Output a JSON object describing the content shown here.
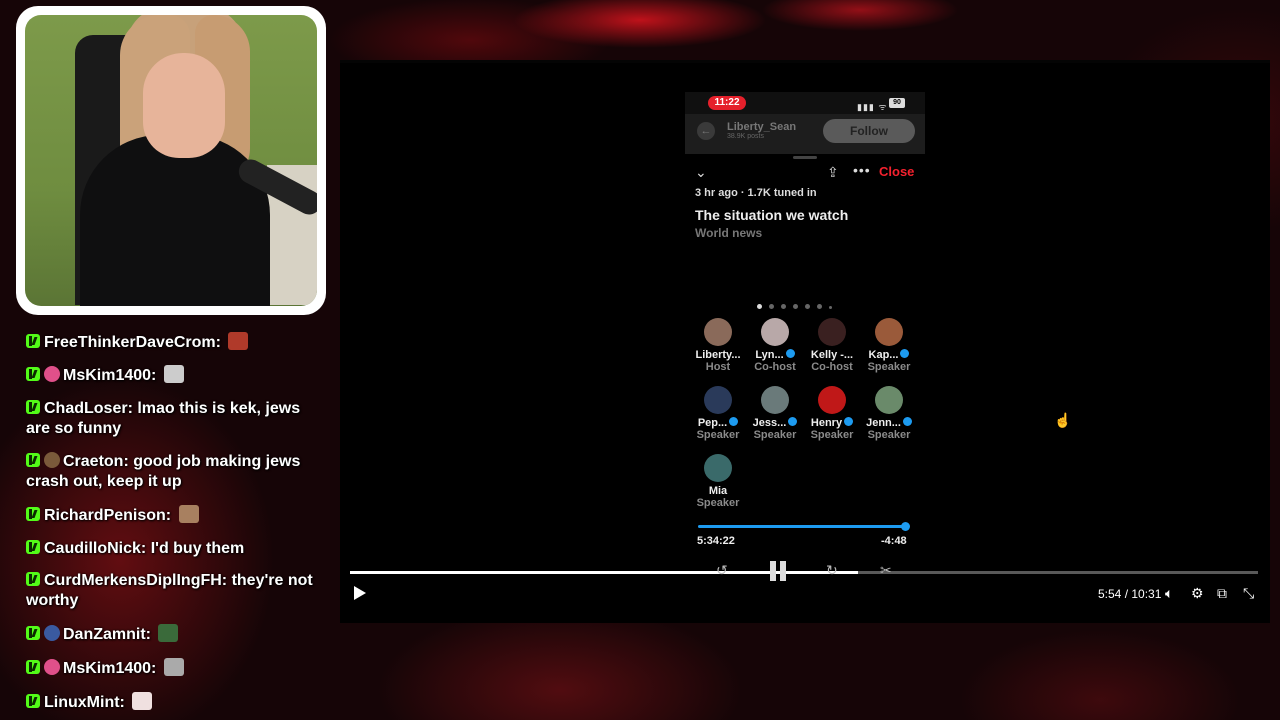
{
  "chat": {
    "messages": [
      {
        "user": "FreeThinkerDaveCrom:",
        "text": ""
      },
      {
        "user": "MsKim1400:",
        "text": ""
      },
      {
        "user": "ChadLoser:",
        "text": "lmao this is kek, jews are so funny"
      },
      {
        "user": "Craeton:",
        "text": "good job making jews crash out, keep it up"
      },
      {
        "user": "RichardPenison:",
        "text": ""
      },
      {
        "user": "CaudilloNick:",
        "text": "I'd buy them"
      },
      {
        "user": "CurdMerkensDiplIngFH:",
        "text": "they're not worthy"
      },
      {
        "user": "DanZamnit:",
        "text": ""
      },
      {
        "user": "MsKim1400:",
        "text": ""
      },
      {
        "user": "LinuxMint:",
        "text": ""
      }
    ]
  },
  "phone": {
    "status_time": "11:22",
    "battery": "90",
    "profile_name": "Liberty_Sean",
    "profile_posts": "38.9K posts",
    "follow_label": "Follow",
    "close_label": "Close",
    "meta": "3 hr ago · 1.7K tuned in",
    "title": "The situation we watch",
    "topic": "World news",
    "speakers": [
      {
        "name": "Liberty...",
        "role": "Host",
        "verified": false,
        "color": "#8a6a5a"
      },
      {
        "name": "Lyn...",
        "role": "Co-host",
        "verified": true,
        "color": "#b8a8a8"
      },
      {
        "name": "Kelly -...",
        "role": "Co-host",
        "verified": false,
        "color": "#3a2020"
      },
      {
        "name": "Kap...",
        "role": "Speaker",
        "verified": true,
        "color": "#9a5a3a"
      },
      {
        "name": "Pep...",
        "role": "Speaker",
        "verified": true,
        "color": "#2a3a5a"
      },
      {
        "name": "Jess...",
        "role": "Speaker",
        "verified": true,
        "color": "#6a7a7a"
      },
      {
        "name": "Henry",
        "role": "Speaker",
        "verified": true,
        "color": "#c01818"
      },
      {
        "name": "Jenn...",
        "role": "Speaker",
        "verified": true,
        "color": "#6a8a6a"
      },
      {
        "name": "Mia",
        "role": "Speaker",
        "verified": false,
        "color": "#3a6a6a"
      }
    ],
    "elapsed": "5:34:22",
    "remaining": "-4:48",
    "progress": 0.98
  },
  "player": {
    "time_display": "5:54 / 10:31",
    "progress": 0.56
  },
  "colors": {
    "kick_green": "#53fc18",
    "x_blue": "#1d9bf0",
    "close_red": "#f4212e"
  },
  "icons": [
    "play-icon",
    "volume-icon",
    "settings-icon",
    "miniplayer-icon",
    "fullscreen-exit-icon",
    "scissors-icon",
    "pause-icon",
    "rewind-icon",
    "forward-icon",
    "share-icon",
    "more-icon",
    "chevron-down-icon",
    "back-icon"
  ]
}
